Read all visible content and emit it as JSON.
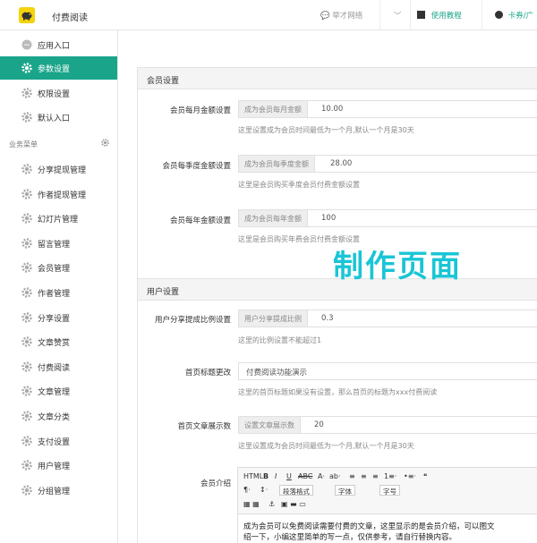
{
  "header": {
    "title": "付费阅读",
    "network": "举才网络",
    "guide": "使用教程",
    "coupon": "卡券/广"
  },
  "sidebar": {
    "top_items": [
      {
        "label": "应用入口",
        "icon": "chat-icon"
      },
      {
        "label": "参数设置",
        "icon": "gear-icon",
        "active": true
      },
      {
        "label": "权限设置",
        "icon": "gear-icon"
      },
      {
        "label": "默认入口",
        "icon": "gear-icon"
      }
    ],
    "section_title": "业务菜单",
    "menu_items": [
      "分享提现管理",
      "作者提现管理",
      "幻灯片管理",
      "留言管理",
      "会员管理",
      "作者管理",
      "分享设置",
      "文章赞赏",
      "付费阅读",
      "文章管理",
      "文章分类",
      "支付设置",
      "用户管理",
      "分组管理"
    ]
  },
  "member_panel": {
    "title": "会员设置",
    "monthly": {
      "label": "会员每月金额设置",
      "addon": "成为会员每月金额",
      "value": "10.00",
      "help": "这里设置成为会员时间最低为一个月,默认一个月是30天"
    },
    "quarterly": {
      "label": "会员每季度金额设置",
      "addon": "成为会员每季度金额",
      "value": "28.00",
      "help": "这里是会员购买季度会员付费金额设置"
    },
    "yearly": {
      "label": "会员每年金额设置",
      "addon": "成为会员每年金额",
      "value": "100",
      "help": "这里是会员购买年费会员付费金额设置"
    }
  },
  "watermark": "制作页面",
  "user_panel": {
    "title": "用户设置",
    "share_ratio": {
      "label": "用户分享提成比例设置",
      "addon": "用户分享提成比例",
      "value": "0.3",
      "help": "这里的比例设置不能超过1"
    },
    "home_title": {
      "label": "首页标题更改",
      "value": "付费阅读功能演示",
      "help": "这里的首页标题如果没有设置，那么首页的标题为xxx付费阅读"
    },
    "article_count": {
      "label": "首页文章展示数",
      "addon": "设置文章展示数",
      "value": "20",
      "help": "这里设置成为会员时间最低为一个月,默认一个月是30天"
    },
    "intro": {
      "label": "会员介绍"
    }
  },
  "editor": {
    "toolbar_row1": [
      "HTML",
      "B",
      "I",
      "U",
      "ABC",
      "A·",
      "ab·",
      "≡",
      "≡",
      "≡",
      "1≡·",
      "•≡·",
      "❝"
    ],
    "paragraph_format": "段落格式",
    "font_family": "字体",
    "font_size": "字号",
    "content_line1": "成为会员可以免费阅读需要付费的文章，这里显示的是会员介绍，可以图文",
    "content_line2": "绍一下，小编这里简单的写一点，仅供参考，请自行替换内容。"
  }
}
